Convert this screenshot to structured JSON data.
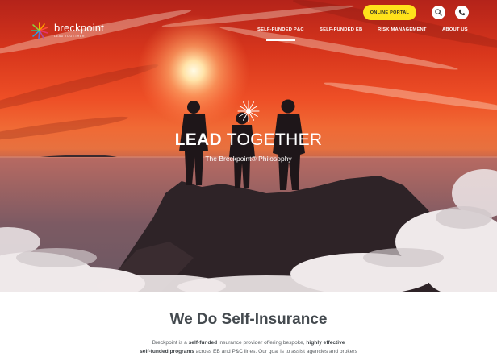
{
  "brand": {
    "name": "breckpoint",
    "tagline": "LEAD TOGETHER"
  },
  "header": {
    "portal_label": "ONLINE PORTAL",
    "search_icon": "search-icon",
    "phone_icon": "phone-icon"
  },
  "nav": {
    "items": [
      {
        "label": "SELF-FUNDED P&C",
        "active": true
      },
      {
        "label": "SELF-FUNDED EB",
        "active": false
      },
      {
        "label": "RISK MANAGEMENT",
        "active": false
      },
      {
        "label": "ABOUT US",
        "active": false
      }
    ]
  },
  "hero": {
    "title_bold": "LEAD",
    "title_rest": " TOGETHER",
    "subtitle": "The Breckpoint® Philosophy"
  },
  "intro": {
    "title_bold": "We Do",
    "title_rest": " Self-Insurance",
    "p1_a": "Breckpoint is a ",
    "p1_b": "self-funded",
    "p1_c": " insurance provider offering bespoke, ",
    "p1_d": "highly effective",
    "p2_a": "self-funded programs",
    "p2_b": " across EB and P&C lines.  Our goal is to assist agencies and brokers"
  },
  "colors": {
    "accent": "#ffe21b",
    "sky_top": "#b4231a",
    "sky_glow": "#f06a35",
    "text_dark": "#444a4f"
  }
}
